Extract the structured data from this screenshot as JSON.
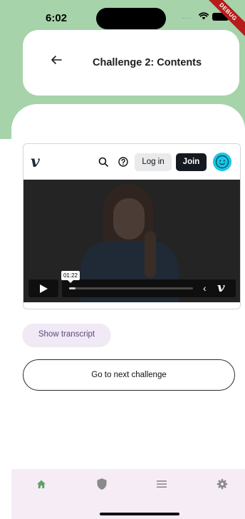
{
  "status_bar": {
    "time": "6:02",
    "signal": "....",
    "debug_label": "DEBUG"
  },
  "header": {
    "title": "Challenge 2: Contents",
    "back_icon": "arrow-left-icon"
  },
  "video_embed": {
    "brand": "v",
    "login_label": "Log in",
    "join_label": "Join",
    "timestamp": "01:22",
    "progress": 0.05,
    "chevron": "‹",
    "brand_mini": "v",
    "colors": {
      "join_bg": "#141a1f",
      "avatar": "#16c6e6"
    }
  },
  "actions": {
    "transcript_label": "Show transcript",
    "next_label": "Go to next challenge"
  },
  "bottom_nav": {
    "items": [
      {
        "icon": "home-icon",
        "active": true
      },
      {
        "icon": "shield-icon",
        "active": false
      },
      {
        "icon": "list-icon",
        "active": false
      },
      {
        "icon": "gear-icon",
        "active": false
      }
    ]
  },
  "colors": {
    "header_bg": "#a6d3a9",
    "nav_bg": "#f6ecf6",
    "accent": "#5d4a74"
  }
}
